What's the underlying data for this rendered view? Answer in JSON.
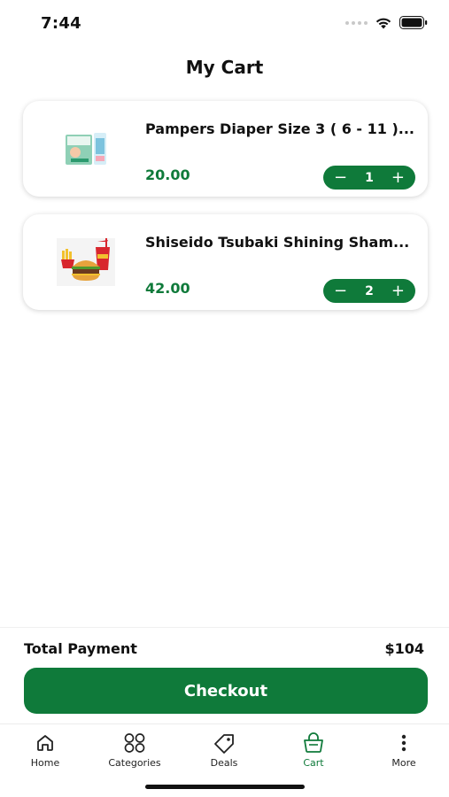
{
  "status_bar": {
    "time": "7:44",
    "icons": [
      "signal-dots-icon",
      "wifi-icon",
      "battery-icon"
    ]
  },
  "header": {
    "title": "My Cart"
  },
  "cart": {
    "items": [
      {
        "name": "Pampers Diaper Size 3 ( 6 - 11 )...",
        "price": "20.00",
        "quantity": "1",
        "thumbnail": "diaper-pack-image"
      },
      {
        "name": "Shiseido Tsubaki Shining Sham...",
        "price": "42.00",
        "quantity": "2",
        "thumbnail": "burger-fries-image"
      }
    ],
    "stepper": {
      "minus": "−",
      "plus": "+"
    }
  },
  "summary": {
    "total_label": "Total Payment",
    "total_value": "$104",
    "checkout_label": "Checkout"
  },
  "tab_bar": {
    "tabs": [
      {
        "label": "Home",
        "icon": "home-icon",
        "active": false
      },
      {
        "label": "Categories",
        "icon": "categories-icon",
        "active": false
      },
      {
        "label": "Deals",
        "icon": "tag-icon",
        "active": false
      },
      {
        "label": "Cart",
        "icon": "basket-icon",
        "active": true
      },
      {
        "label": "More",
        "icon": "more-vertical-icon",
        "active": false
      }
    ]
  },
  "colors": {
    "brand_green": "#0f7a3a",
    "text_dark": "#111111",
    "card_shadow": "#d9d9d9"
  }
}
